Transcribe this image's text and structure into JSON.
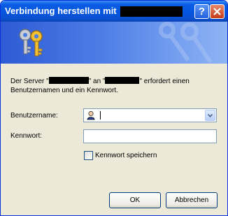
{
  "window": {
    "title": "Verbindung herstellen mit",
    "help_glyph": "?",
    "close_icon": "close-icon",
    "title_color": "#0a5de3"
  },
  "banner": {
    "icon": "keys-icon",
    "background_color": "#2d5bd4"
  },
  "message": {
    "part1": "Der Server \"",
    "part2": "\" an \"",
    "part3": "\" erfordert einen",
    "line2": "Benutzernamen und ein Kennwort."
  },
  "form": {
    "username_label": "Benutzername:",
    "username_value": "",
    "username_icon": "user-icon",
    "password_label": "Kennwort:",
    "password_value": "",
    "remember_label": "Kennwort speichern",
    "remember_checked": false
  },
  "buttons": {
    "ok": "OK",
    "cancel": "Abbrechen"
  }
}
